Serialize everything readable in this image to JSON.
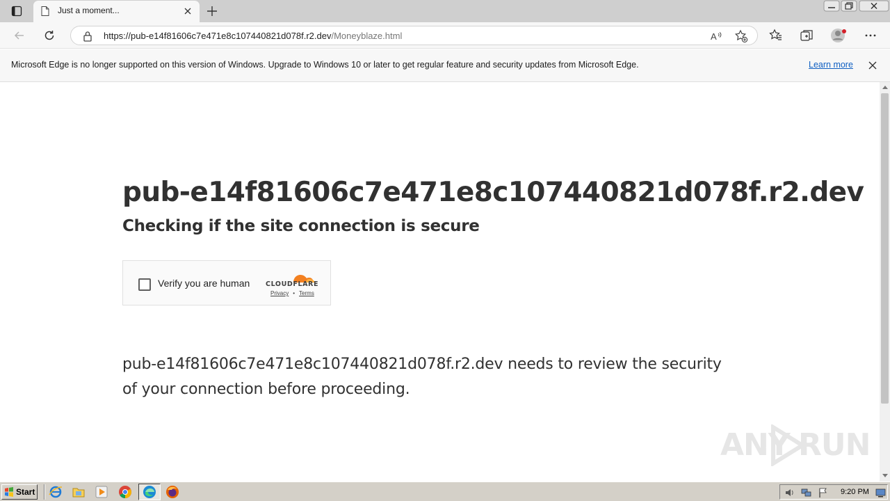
{
  "browser": {
    "tab": {
      "title": "Just a moment..."
    },
    "address": {
      "url_host": "https://pub-e14f81606c7e471e8c107440821d078f.r2.dev",
      "url_path": "/Moneyblaze.html"
    },
    "infobar": {
      "message": "Microsoft Edge is no longer supported on this version of Windows. Upgrade to Windows 10 or later to get regular feature and security updates from Microsoft Edge.",
      "link": "Learn more"
    }
  },
  "page": {
    "hostname": "pub-e14f81606c7e471e8c107440821d078f.r2.dev",
    "subtitle": "Checking if the site connection is secure",
    "widget": {
      "checkbox_label": "Verify you are human",
      "brand": "CLOUDFLARE",
      "privacy": "Privacy",
      "separator": "•",
      "terms": "Terms"
    },
    "description": "pub-e14f81606c7e471e8c107440821d078f.r2.dev needs to review the security of your connection before proceeding."
  },
  "watermark": {
    "left": "ANY",
    "right": "RUN"
  },
  "taskbar": {
    "start_label": "Start",
    "clock": "9:20 PM"
  },
  "colors": {
    "cloudflare_orange": "#f38020",
    "cloudflare_light": "#faae40",
    "link_blue": "#0f5fc2"
  }
}
